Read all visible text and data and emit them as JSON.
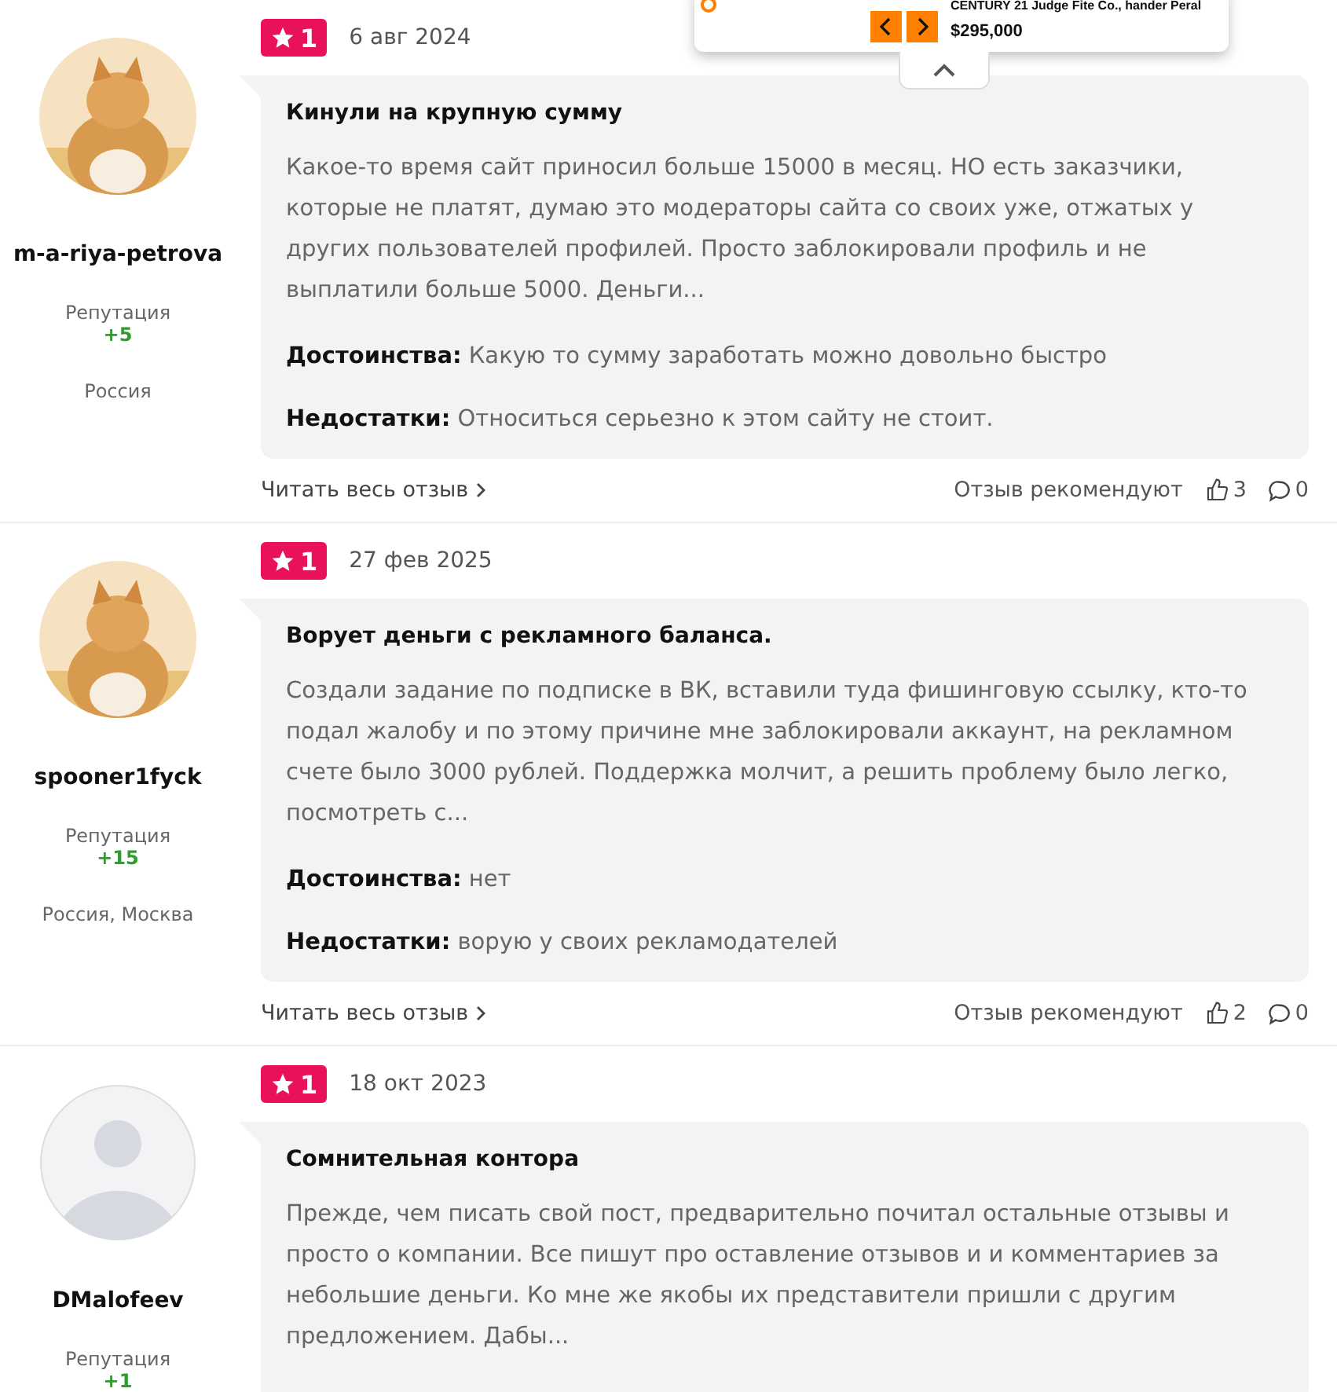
{
  "reviews": [
    {
      "author": "m-a-riya-petrova",
      "reputation_label": "Репутация",
      "reputation": "+5",
      "location": "Россия",
      "rating": "1",
      "date": "6 авг 2024",
      "title": "Кинули на крупную сумму",
      "text": "Какое-то время сайт приносил больше 15000 в месяц. НО есть заказчики, которые не платят, думаю это модераторы сайта со своих уже, отжатых у других пользователей профилей. Просто заблокировали профиль и не выплатили больше 5000. Деньги...",
      "pros_label": "Достоинства:",
      "pros": "Какую то сумму заработать можно довольно быстро",
      "cons_label": "Недостатки:",
      "cons": "Относиться серьезно к этом сайту не стоит.",
      "read_more": "Читать весь отзыв",
      "recommend_label": "Отзыв рекомендуют",
      "likes": "3",
      "comments": "0"
    },
    {
      "author": "spooner1fyck",
      "reputation_label": "Репутация",
      "reputation": "+15",
      "location": "Россия, Москва",
      "rating": "1",
      "date": "27 фев 2025",
      "title": "Ворует деньги с рекламного баланса.",
      "text": "Создали задание по подписке в ВК, вставили туда фишинговую ссылку, кто-то подал жалобу и по этому причине мне заблокировали аккаунт, на рекламном счете было 3000 рублей. Поддержка молчит, а решить проблему было легко, посмотреть с...",
      "pros_label": "Достоинства:",
      "pros": "нет",
      "cons_label": "Недостатки:",
      "cons": "ворую у своих рекламодателей",
      "read_more": "Читать весь отзыв",
      "recommend_label": "Отзыв рекомендуют",
      "likes": "2",
      "comments": "0"
    },
    {
      "author": "DMalofeev",
      "avatar": {
        "kind": "placeholder"
      },
      "reputation_label": "Репутация",
      "reputation": "+1",
      "rating": "1",
      "date": "18 окт 2023",
      "title": "Сомнительная контора",
      "text": "Прежде, чем писать свой пост, предварительно почитал остальные отзывы и просто о компании. Все пишут про оставление отзывов и и комментариев за небольшие деньги. Ко мне же якобы их представители пришли с другим предложением. Дабы..."
    }
  ],
  "ad": {
    "listing": "CENTURY 21 Judge Fite Co., hander Peral",
    "price": "$295,000"
  }
}
